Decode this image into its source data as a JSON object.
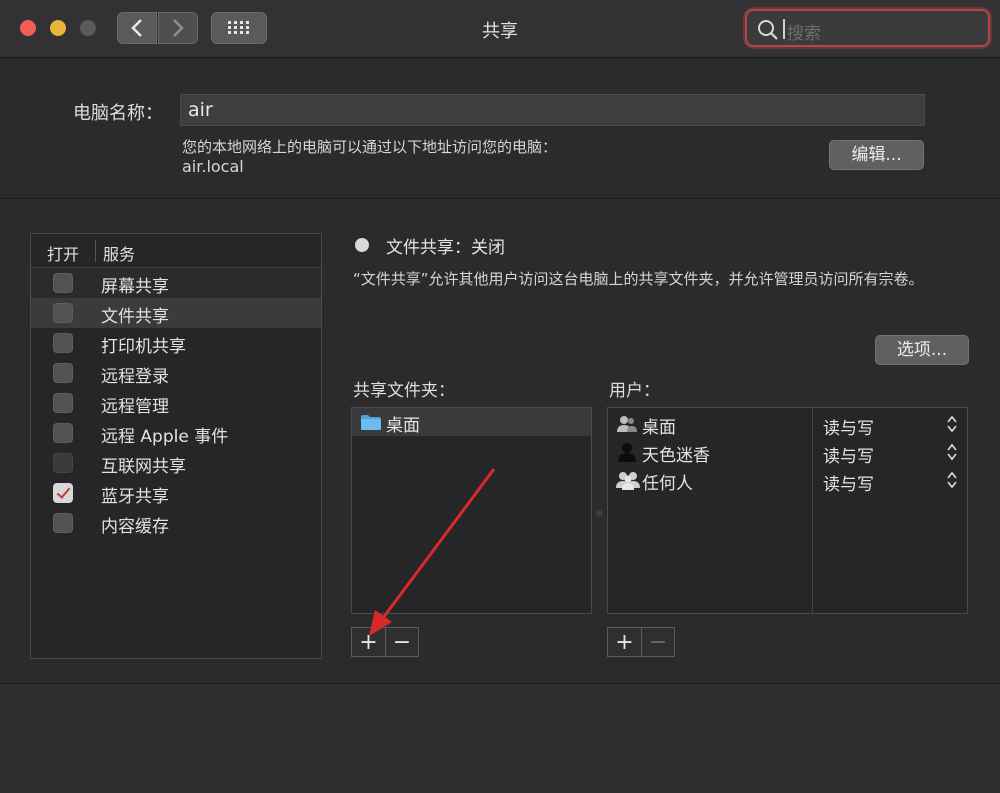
{
  "window": {
    "title": "共享"
  },
  "search": {
    "placeholder": "搜索"
  },
  "computer": {
    "name_label": "电脑名称：",
    "name_value": "air",
    "network_desc": "您的本地网络上的电脑可以通过以下地址访问您的电脑：",
    "network_addr": "air.local",
    "edit_label": "编辑..."
  },
  "services": {
    "col_on": "打开",
    "col_service": "服务",
    "items": [
      {
        "label": "屏幕共享",
        "checked": false
      },
      {
        "label": "文件共享",
        "checked": false,
        "selected": true
      },
      {
        "label": "打印机共享",
        "checked": false
      },
      {
        "label": "远程登录",
        "checked": false
      },
      {
        "label": "远程管理",
        "checked": false
      },
      {
        "label": "远程 Apple 事件",
        "checked": false
      },
      {
        "label": "互联网共享",
        "checked": false
      },
      {
        "label": "蓝牙共享",
        "checked": true
      },
      {
        "label": "内容缓存",
        "checked": false
      }
    ]
  },
  "status": {
    "label": "文件共享：关闭",
    "description": "“文件共享”允许其他用户访问这台电脑上的共享文件夹，并允许管理员访问所有宗卷。"
  },
  "options_label": "选项...",
  "shared_folders": {
    "title": "共享文件夹：",
    "items": [
      "桌面"
    ]
  },
  "users": {
    "title": "用户：",
    "items": [
      {
        "name": "桌面",
        "perm": "读与写",
        "icon": "user-group-small-icon"
      },
      {
        "name": "天色迷香",
        "perm": "读与写",
        "icon": "user-icon"
      },
      {
        "name": "任何人",
        "perm": "读与写",
        "icon": "group-icon"
      }
    ]
  },
  "controls": {
    "add": "+",
    "remove": "−"
  },
  "colors": {
    "accent_red": "#c63a3a",
    "arrow": "#d82a2a"
  }
}
